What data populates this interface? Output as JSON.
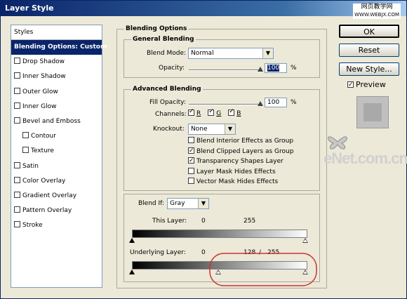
{
  "window": {
    "title": "Layer Style"
  },
  "watermark": {
    "site": "网页教学网",
    "url": "WWW.WEBJX.COM"
  },
  "logo_text": "eNet.com.cn",
  "styles_list": {
    "header": "Styles",
    "items": [
      {
        "label": "Blending Options: Custom",
        "selected": true,
        "checkbox": false
      },
      {
        "label": "Drop Shadow",
        "checkbox": true,
        "checked": false
      },
      {
        "label": "Inner Shadow",
        "checkbox": true,
        "checked": false
      },
      {
        "label": "Outer Glow",
        "checkbox": true,
        "checked": false
      },
      {
        "label": "Inner Glow",
        "checkbox": true,
        "checked": false
      },
      {
        "label": "Bevel and Emboss",
        "checkbox": true,
        "checked": false
      },
      {
        "label": "Contour",
        "checkbox": true,
        "checked": false,
        "indent": true
      },
      {
        "label": "Texture",
        "checkbox": true,
        "checked": false,
        "indent": true
      },
      {
        "label": "Satin",
        "checkbox": true,
        "checked": false
      },
      {
        "label": "Color Overlay",
        "checkbox": true,
        "checked": false
      },
      {
        "label": "Gradient Overlay",
        "checkbox": true,
        "checked": false
      },
      {
        "label": "Pattern Overlay",
        "checkbox": true,
        "checked": false
      },
      {
        "label": "Stroke",
        "checkbox": true,
        "checked": false
      }
    ]
  },
  "blending_options": {
    "title": "Blending Options",
    "general": {
      "title": "General Blending",
      "blend_mode_label": "Blend Mode:",
      "blend_mode_value": "Normal",
      "opacity_label": "Opacity:",
      "opacity_value": "100",
      "opacity_unit": "%",
      "opacity_level": 1.0
    },
    "advanced": {
      "title": "Advanced Blending",
      "fill_opacity_label": "Fill Opacity:",
      "fill_opacity_value": "100",
      "fill_opacity_unit": "%",
      "fill_opacity_level": 1.0,
      "channels_label": "Channels:",
      "channels": [
        {
          "label": "R",
          "checked": true
        },
        {
          "label": "G",
          "checked": true
        },
        {
          "label": "B",
          "checked": true
        }
      ],
      "knockout_label": "Knockout:",
      "knockout_value": "None",
      "options": [
        {
          "label": "Blend Interior Effects as Group",
          "checked": false
        },
        {
          "label": "Blend Clipped Layers as Group",
          "checked": true
        },
        {
          "label": "Transparency Shapes Layer",
          "checked": true
        },
        {
          "label": "Layer Mask Hides Effects",
          "checked": false
        },
        {
          "label": "Vector Mask Hides Effects",
          "checked": false
        }
      ]
    },
    "blend_if": {
      "label": "Blend If:",
      "value": "Gray",
      "this_layer_label": "This Layer:",
      "this_layer_low": "0",
      "this_layer_high": "255",
      "underlying_label": "Underlying Layer:",
      "underlying_low": "0",
      "underlying_split": "128",
      "underlying_sep": "/",
      "underlying_high": "255"
    }
  },
  "buttons": {
    "ok": "OK",
    "reset": "Reset",
    "new_style": "New Style...",
    "preview_label": "Preview",
    "preview_checked": true
  },
  "colors": {
    "title_bar": "#0a246a",
    "selected_row": "#0a246a",
    "highlight_ellipse": "#cc3333"
  }
}
